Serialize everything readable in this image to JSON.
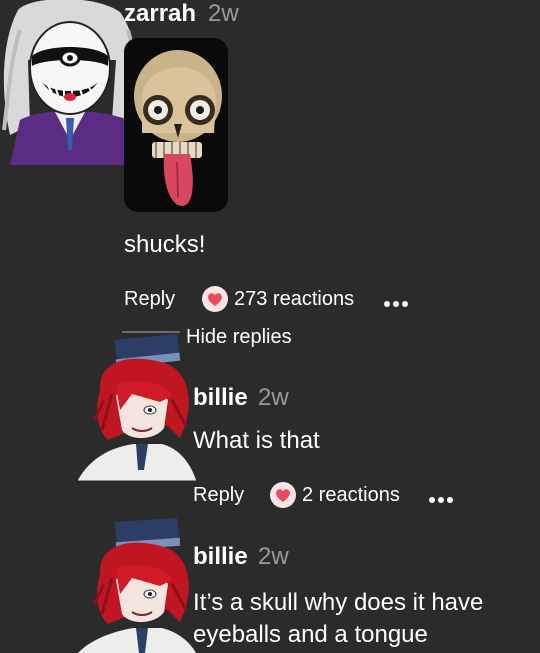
{
  "comments": [
    {
      "username": "zarrah",
      "time": "2w",
      "text": "shucks!",
      "reply_label": "Reply",
      "reactions": "273 reactions",
      "sticker": "skull-with-eyes-and-tongue"
    },
    {
      "username": "billie",
      "time": "2w",
      "text": "What is that",
      "reply_label": "Reply",
      "reactions": "2 reactions"
    },
    {
      "username": "billie",
      "time": "2w",
      "text_line1": "It’s a skull why does it have",
      "text_line2": "eyeballs and a tongue"
    }
  ],
  "hide_replies": "Hide replies",
  "colors": {
    "background": "#2b2b2b",
    "muted_text": "#9a9a9a",
    "heart": "#e84a5f",
    "reaction_badge": "#fbe3e6"
  },
  "icons": [
    "heart-reaction-icon",
    "more-options-icon"
  ]
}
